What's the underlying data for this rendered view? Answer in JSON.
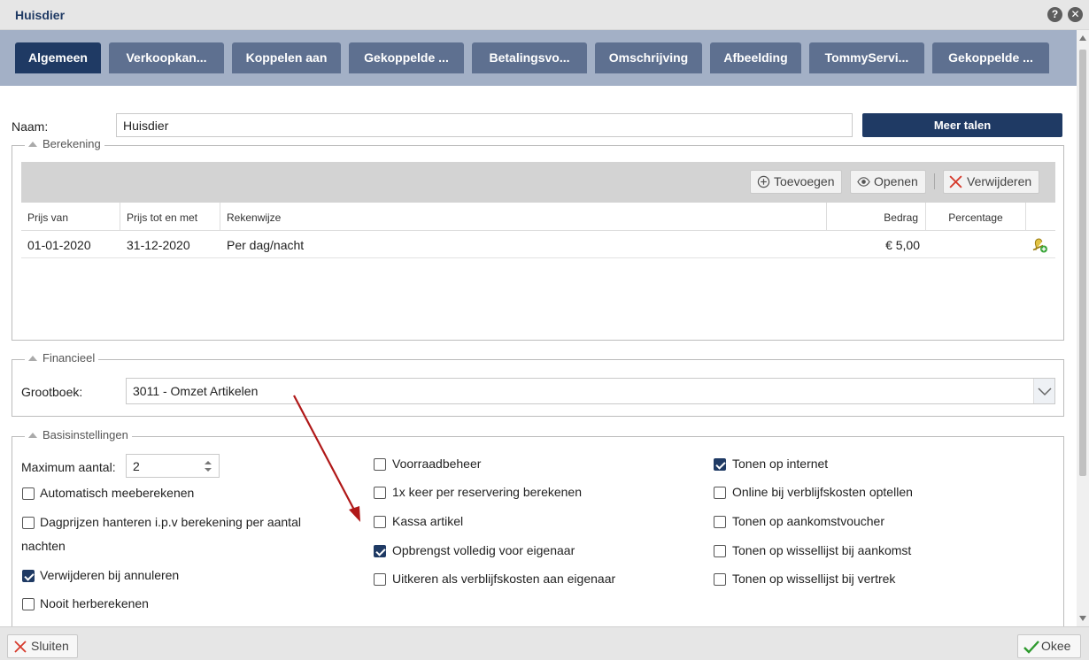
{
  "window": {
    "title": "Huisdier",
    "help": "?",
    "close": "✕"
  },
  "tabs": [
    {
      "label": "Algemeen",
      "active": true
    },
    {
      "label": "Verkoopkan..."
    },
    {
      "label": "Koppelen aan"
    },
    {
      "label": "Gekoppelde ..."
    },
    {
      "label": "Betalingsvo..."
    },
    {
      "label": "Omschrijving"
    },
    {
      "label": "Afbeelding"
    },
    {
      "label": "TommyServi..."
    },
    {
      "label": "Gekoppelde ..."
    }
  ],
  "form": {
    "name_label": "Naam:",
    "name_value": "Huisdier",
    "more_languages": "Meer talen"
  },
  "berekening": {
    "legend": "Berekening",
    "toolbar": {
      "add": "Toevoegen",
      "open": "Openen",
      "delete": "Verwijderen"
    },
    "columns": [
      "Prijs van",
      "Prijs tot en met",
      "Rekenwijze",
      "Bedrag",
      "Percentage"
    ],
    "rows": [
      {
        "from": "01-01-2020",
        "to": "31-12-2020",
        "method": "Per dag/nacht",
        "amount": "€ 5,00",
        "percentage": ""
      }
    ]
  },
  "financieel": {
    "legend": "Financieel",
    "ledger_label": "Grootboek:",
    "ledger_value": "3011 - Omzet Artikelen"
  },
  "basis": {
    "legend": "Basisinstellingen",
    "max_label": "Maximum aantal:",
    "max_value": "2",
    "col1": [
      {
        "label": "Automatisch meeberekenen",
        "checked": false
      },
      {
        "label": "Dagprijzen hanteren i.p.v berekening per aantal",
        "label2": "nachten",
        "checked": false
      },
      {
        "label": "Verwijderen bij annuleren",
        "checked": true
      },
      {
        "label": "Nooit herberekenen",
        "checked": false
      }
    ],
    "col2": [
      {
        "label": "Voorraadbeheer",
        "checked": false
      },
      {
        "label": "1x keer per reservering berekenen",
        "checked": false
      },
      {
        "label": "Kassa artikel",
        "checked": false
      },
      {
        "label": "Opbrengst volledig voor eigenaar",
        "checked": true
      },
      {
        "label": "Uitkeren als verblijfskosten aan eigenaar",
        "checked": false
      }
    ],
    "col3": [
      {
        "label": "Tonen op internet",
        "checked": true
      },
      {
        "label": "Online bij verblijfskosten optellen",
        "checked": false
      },
      {
        "label": "Tonen op aankomstvoucher",
        "checked": false
      },
      {
        "label": "Tonen op wissellijst bij aankomst",
        "checked": false
      },
      {
        "label": "Tonen op wissellijst bij vertrek",
        "checked": false
      }
    ]
  },
  "footer": {
    "close": "Sluiten",
    "ok": "Okee"
  },
  "colors": {
    "navy": "#1f3a64",
    "tab": "#5e7090",
    "tabbar": "#a3b0c6",
    "arrow": "#b01818"
  }
}
